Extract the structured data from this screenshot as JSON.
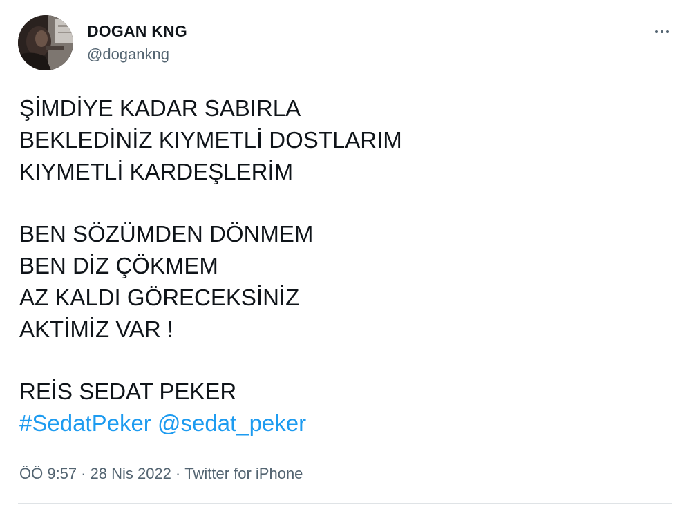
{
  "user": {
    "display_name": "DOGAN KNG",
    "handle": "@dogankng"
  },
  "tweet": {
    "lines_block1": [
      "ŞİMDİYE KADAR SABIRLA",
      "BEKLEDİNİZ KIYMETLİ DOSTLARIM",
      "KIYMETLİ KARDEŞLERİM"
    ],
    "lines_block2": [
      "BEN SÖZÜMDEN DÖNMEM",
      "BEN DİZ ÇÖKMEM",
      "AZ KALDI GÖRECEKSİNİZ",
      "AKTİMİZ VAR !"
    ],
    "lines_block3": [
      "REİS SEDAT PEKER"
    ],
    "hashtag": "#SedatPeker",
    "mention": "@sedat_peker"
  },
  "meta": {
    "time": "ÖÖ 9:57",
    "separator": "·",
    "date": "28 Nis 2022",
    "source": "Twitter for iPhone"
  },
  "icons": {
    "more": "more-horizontal-icon",
    "avatar": "profile-avatar"
  },
  "colors": {
    "text": "#0f1419",
    "secondary": "#536471",
    "link": "#1d9bf0",
    "divider": "#dfe3e6"
  }
}
